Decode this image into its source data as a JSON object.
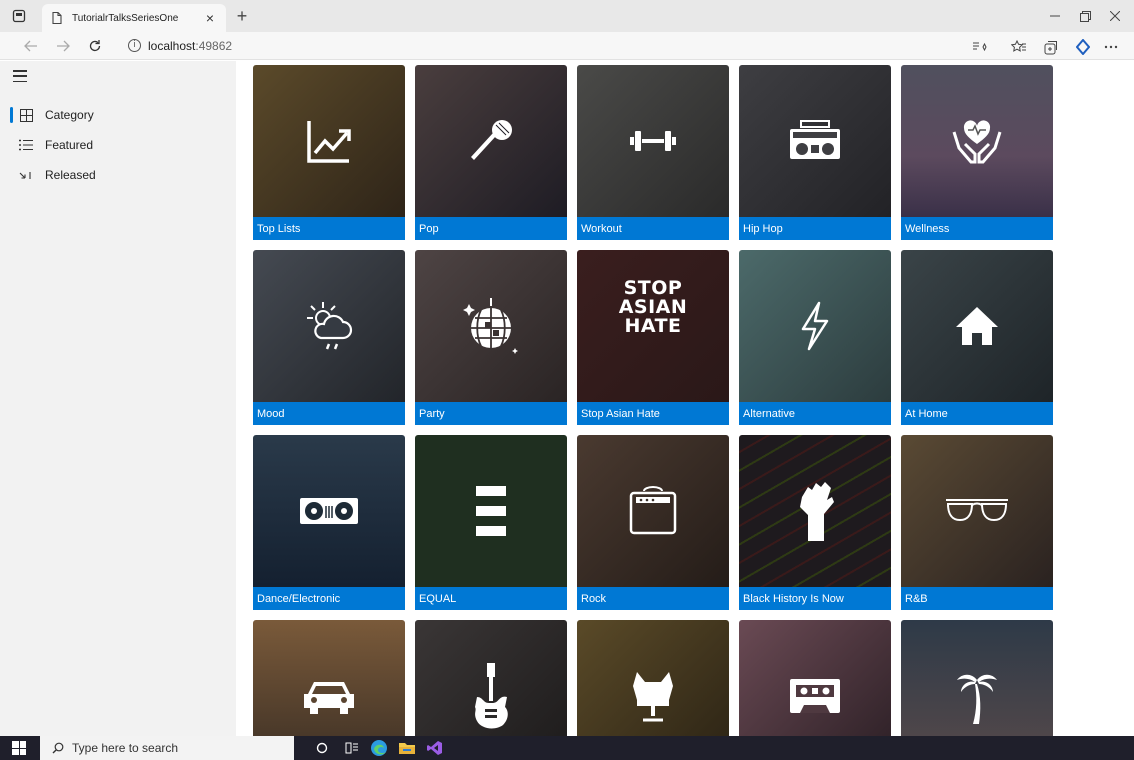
{
  "browser": {
    "tab_title": "TutorialrTalksSeriesOne",
    "tab_close": "×",
    "new_tab": "+",
    "url_host": "localhost",
    "url_port": ":49862"
  },
  "sidebar": {
    "items": [
      {
        "label": "Category",
        "icon": "grid-icon",
        "active": true
      },
      {
        "label": "Featured",
        "icon": "list-icon",
        "active": false
      },
      {
        "label": "Released",
        "icon": "download-icon",
        "active": false
      }
    ]
  },
  "categories": [
    {
      "label": "Top Lists",
      "icon": "trending-up-icon",
      "color": "#4a3f28"
    },
    {
      "label": "Pop",
      "icon": "microphone-icon",
      "color": "#2d2a33"
    },
    {
      "label": "Workout",
      "icon": "dumbbell-icon",
      "color": "#3b3b3b"
    },
    {
      "label": "Hip Hop",
      "icon": "boombox-icon",
      "color": "#2f3033"
    },
    {
      "label": "Wellness",
      "icon": "heart-hands-icon",
      "color": "#4d4a5c"
    },
    {
      "label": "Mood",
      "icon": "weather-icon",
      "color": "#3a3c40"
    },
    {
      "label": "Party",
      "icon": "disco-ball-icon",
      "color": "#3c3434"
    },
    {
      "label": "Stop Asian Hate",
      "icon": "stop-asian-hate-text",
      "color": "#2e1e1e",
      "art_text": "STOP ASIAN HATE"
    },
    {
      "label": "Alternative",
      "icon": "lightning-icon",
      "color": "#3c4c4c"
    },
    {
      "label": "At Home",
      "icon": "house-icon",
      "color": "#2e3538"
    },
    {
      "label": "Dance/Electronic",
      "icon": "turntable-icon",
      "color": "#1d2a36"
    },
    {
      "label": "EQUAL",
      "icon": "equal-bars-icon",
      "color": "#1f2f20"
    },
    {
      "label": "Rock",
      "icon": "amplifier-icon",
      "color": "#3a302a"
    },
    {
      "label": "Black History Is Now",
      "icon": "raised-fist-icon",
      "color": "#1e1a1e"
    },
    {
      "label": "R&B",
      "icon": "sunglasses-icon",
      "color": "#3d3228"
    },
    {
      "label": "",
      "icon": "car-icon",
      "color": "#6b5238"
    },
    {
      "label": "",
      "icon": "guitar-icon",
      "color": "#2c2a2a"
    },
    {
      "label": "",
      "icon": "chair-icon",
      "color": "#4a3c22"
    },
    {
      "label": "",
      "icon": "cassette-icon",
      "color": "#4f3940"
    },
    {
      "label": "",
      "icon": "palm-tree-icon",
      "color": "#38424e"
    }
  ],
  "taskbar": {
    "search_placeholder": "Type here to search"
  }
}
